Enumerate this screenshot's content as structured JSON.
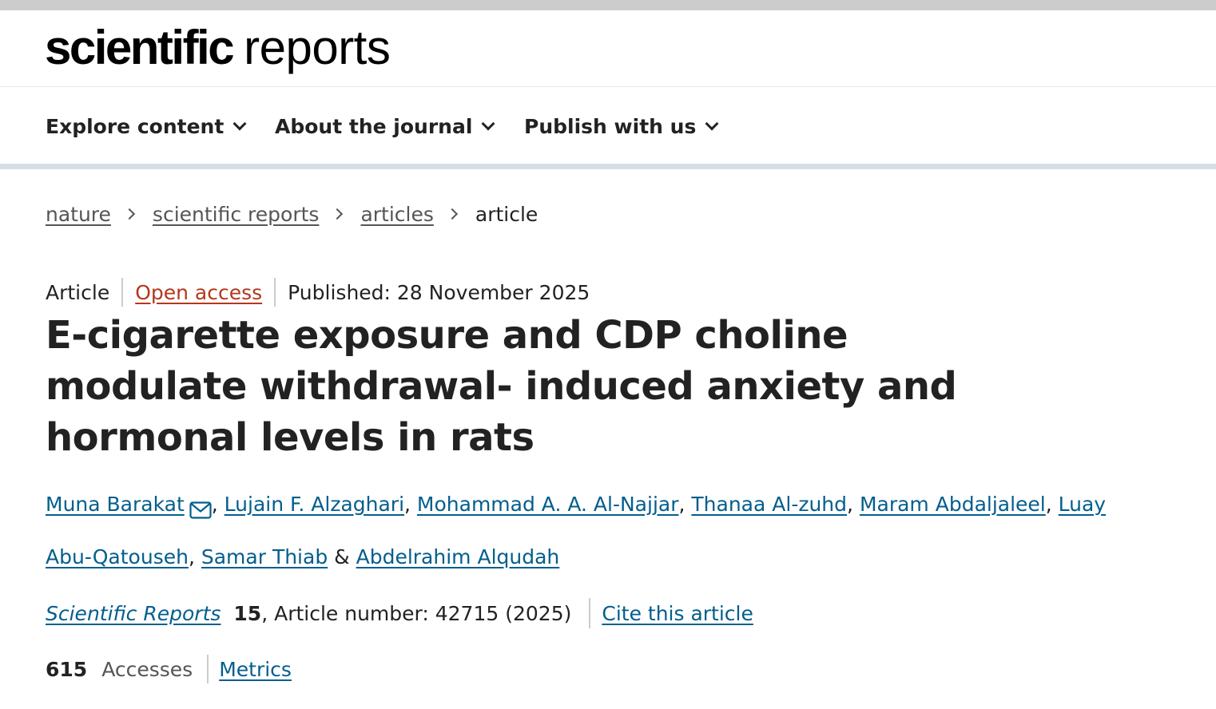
{
  "masthead": {
    "logo_bold": "scientific",
    "logo_light": "reports"
  },
  "nav": {
    "items": [
      {
        "label": "Explore content"
      },
      {
        "label": "About the journal"
      },
      {
        "label": "Publish with us"
      }
    ]
  },
  "breadcrumb": {
    "links": [
      "nature",
      "scientific reports",
      "articles"
    ],
    "current": "article"
  },
  "article": {
    "type": "Article",
    "access": "Open access",
    "published": "Published: 28 November 2025",
    "title": "E-cigarette exposure and CDP choline modulate withdrawal- induced anxiety and hormonal levels in rats",
    "authors": [
      "Muna Barakat",
      "Lujain F. Alzaghari",
      "Mohammad A. A. Al-Najjar",
      "Thanaa Al-zuhd",
      "Maram Abdaljaleel",
      "Luay Abu-Qatouseh",
      "Samar Thiab",
      "Abdelrahim Alqudah"
    ],
    "author_separator": ",",
    "author_final_separator": "&",
    "corresponding_icon": "envelope-icon"
  },
  "citation": {
    "journal": "Scientific Reports",
    "volume": "15",
    "article_number_text": ", Article number: 42715 (2025)",
    "cite_label": "Cite this article"
  },
  "metrics": {
    "accesses_count": "615",
    "accesses_label": "Accesses",
    "metrics_label": "Metrics"
  },
  "colors": {
    "link_blue": "#025e8d",
    "open_access_orange": "#b4371c",
    "text_dark": "#222222",
    "text_muted": "#555555",
    "top_strip": "#cccccc",
    "nav_rule": "#d6dfe4"
  }
}
